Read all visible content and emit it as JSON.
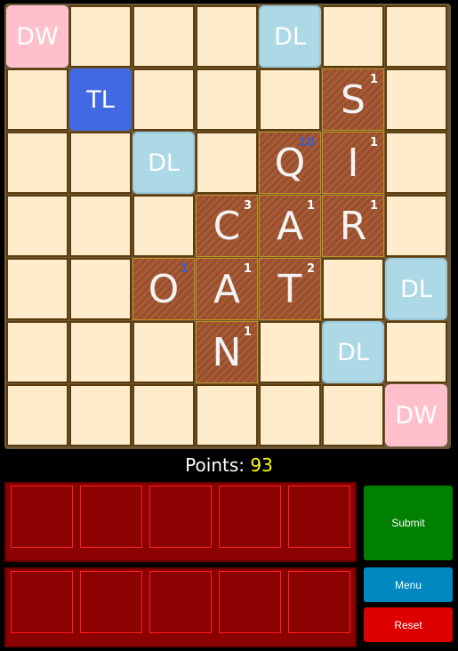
{
  "board": {
    "size": 7,
    "cells": [
      {
        "r": 0,
        "c": 0,
        "type": "dw",
        "label": "DW"
      },
      {
        "r": 0,
        "c": 4,
        "type": "dl",
        "label": "DL"
      },
      {
        "r": 1,
        "c": 1,
        "type": "tl",
        "label": "TL"
      },
      {
        "r": 1,
        "c": 5,
        "type": "tile",
        "letter": "S",
        "score": "1"
      },
      {
        "r": 2,
        "c": 2,
        "type": "dl",
        "label": "DL"
      },
      {
        "r": 2,
        "c": 4,
        "type": "tile",
        "letter": "Q",
        "score": "10",
        "bonus": true
      },
      {
        "r": 2,
        "c": 5,
        "type": "tile",
        "letter": "I",
        "score": "1"
      },
      {
        "r": 3,
        "c": 3,
        "type": "tile",
        "letter": "C",
        "score": "3"
      },
      {
        "r": 3,
        "c": 4,
        "type": "tile",
        "letter": "A",
        "score": "1"
      },
      {
        "r": 3,
        "c": 5,
        "type": "tile",
        "letter": "R",
        "score": "1"
      },
      {
        "r": 4,
        "c": 2,
        "type": "tile",
        "letter": "O",
        "score": "1",
        "bonus": true
      },
      {
        "r": 4,
        "c": 3,
        "type": "tile",
        "letter": "A",
        "score": "1"
      },
      {
        "r": 4,
        "c": 4,
        "type": "tile",
        "letter": "T",
        "score": "2"
      },
      {
        "r": 4,
        "c": 6,
        "type": "dl",
        "label": "DL"
      },
      {
        "r": 5,
        "c": 3,
        "type": "tile",
        "letter": "N",
        "score": "1"
      },
      {
        "r": 5,
        "c": 5,
        "type": "dl",
        "label": "DL"
      },
      {
        "r": 6,
        "c": 6,
        "type": "dw",
        "label": "DW"
      }
    ]
  },
  "points": {
    "label": "Points:",
    "value": "93"
  },
  "racks": [
    {
      "slots": [
        "",
        "",
        "",
        "",
        ""
      ]
    },
    {
      "slots": [
        "",
        "",
        "",
        "",
        ""
      ]
    }
  ],
  "buttons": {
    "submit": {
      "label": "Submit",
      "color": "#008000"
    },
    "menu": {
      "label": "Menu",
      "color": "#0088c0"
    },
    "reset": {
      "label": "Reset",
      "color": "#dd0000"
    }
  }
}
